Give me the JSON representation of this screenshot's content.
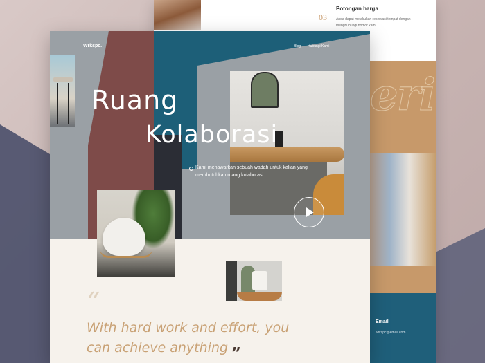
{
  "brand": "Wrkspc.",
  "nav": {
    "links": [
      "Blog",
      "Hubungi Kami"
    ]
  },
  "hero": {
    "title_line1": "Ruang",
    "title_line2": "Kolaborasi",
    "intro": "Kami menawarkan sebuah wadah untuk kalian yang membutuhkan ruang kolaborasi"
  },
  "quote": {
    "open_mark": "“",
    "text": "With hard work and effort, you can achieve anything",
    "close_mark": "”"
  },
  "back_page": {
    "feature_number": "03",
    "feature_title": "Potongan harga",
    "feature_text": "Anda dapat melakukan reservasi tempat dengan menghubungi nomor kami",
    "script_word": "eri",
    "contact_heading": "Email",
    "contact_email": "wrkspc@email.com"
  },
  "colors": {
    "teal": "#1d5f78",
    "tan": "#c7996a",
    "quote_text": "#c9a276",
    "maroon": "#7e4b49"
  },
  "icons": {
    "play": "play-icon",
    "bullet": "circle-bullet-icon"
  }
}
